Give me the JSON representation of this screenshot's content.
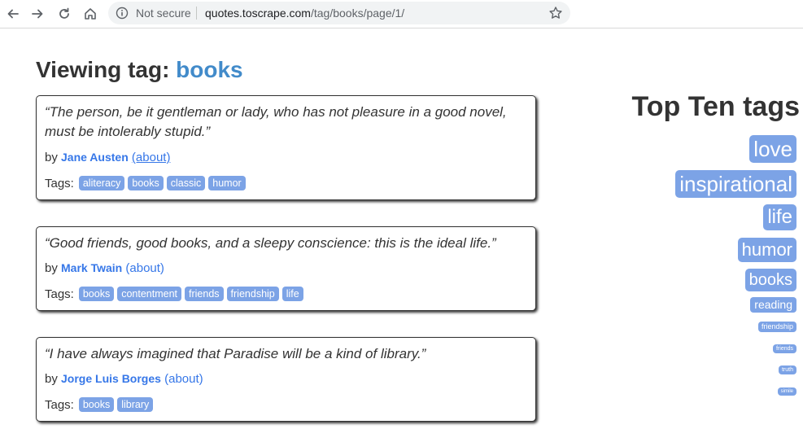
{
  "browser": {
    "not_secure": "Not secure",
    "url_host": "quotes.toscrape.com",
    "url_path": "/tag/books/page/1/"
  },
  "page": {
    "heading_prefix": "Viewing tag:",
    "heading_tag": "books"
  },
  "quotes": [
    {
      "text": "“The person, be it gentleman or lady, who has not pleasure in a good novel, must be intolerably stupid.”",
      "by": "by",
      "author": "Jane Austen",
      "about": "(about)",
      "tags_label": "Tags:",
      "tags": [
        "aliteracy",
        "books",
        "classic",
        "humor"
      ]
    },
    {
      "text": "“Good friends, good books, and a sleepy conscience: this is the ideal life.”",
      "by": "by",
      "author": "Mark Twain",
      "about": "(about)",
      "tags_label": "Tags:",
      "tags": [
        "books",
        "contentment",
        "friends",
        "friendship",
        "life"
      ]
    },
    {
      "text": "“I have always imagined that Paradise will be a kind of library.”",
      "by": "by",
      "author": "Jorge Luis Borges",
      "about": "(about)",
      "tags_label": "Tags:",
      "tags": [
        "books",
        "library"
      ]
    }
  ],
  "sidebar": {
    "title": "Top Ten tags",
    "tags": [
      "love",
      "inspirational",
      "life",
      "humor",
      "books",
      "reading",
      "friendship",
      "friends",
      "truth",
      "simile"
    ]
  }
}
